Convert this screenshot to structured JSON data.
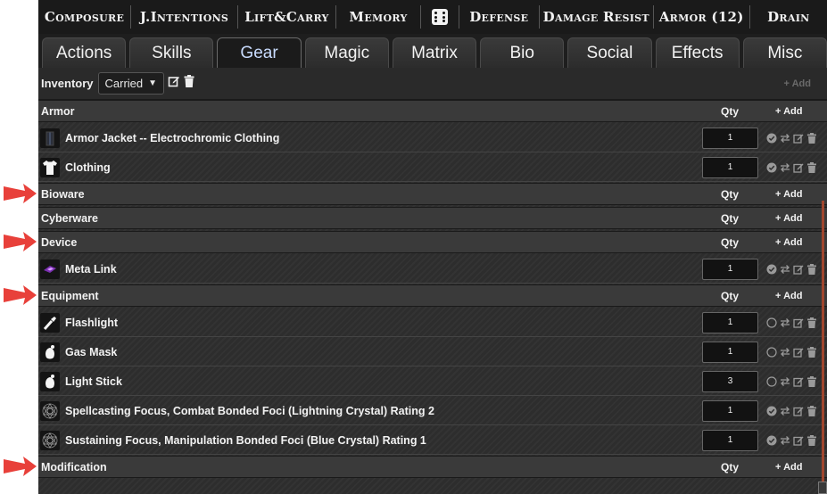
{
  "stats": [
    {
      "label": "Composure",
      "width": 104
    },
    {
      "label": "J.Intentions",
      "width": 120
    },
    {
      "label": "Lift&Carry",
      "width": 110
    },
    {
      "label": "Memory",
      "width": 95
    },
    {
      "label": "",
      "width": 42,
      "dice": true
    },
    {
      "label": "Defense",
      "width": 90
    },
    {
      "label": "Damage Resist",
      "width": 128
    },
    {
      "label": "Armor (12)",
      "width": 108
    },
    {
      "label": "Drain",
      "width": 87
    }
  ],
  "tabs": [
    "Actions",
    "Skills",
    "Gear",
    "Magic",
    "Matrix",
    "Bio",
    "Social",
    "Effects",
    "Misc"
  ],
  "active_tab": "Gear",
  "inventory": {
    "label": "Inventory",
    "selected": "Carried",
    "add_label": "+ Add"
  },
  "qty_header": "Qty",
  "add_label": "Add",
  "sections": [
    {
      "title": "Armor",
      "items": [
        {
          "name": "Armor Jacket -- Electrochromic Clothing",
          "qty": "1",
          "icon": "jacket-icon",
          "equipped": true
        },
        {
          "name": "Clothing",
          "qty": "1",
          "icon": "shirt-icon",
          "equipped": true
        }
      ]
    },
    {
      "title": "Bioware",
      "items": []
    },
    {
      "title": "Cyberware",
      "items": []
    },
    {
      "title": "Device",
      "items": [
        {
          "name": "Meta Link",
          "qty": "1",
          "icon": "commlink-icon",
          "equipped": true
        }
      ]
    },
    {
      "title": "Equipment",
      "items": [
        {
          "name": "Flashlight",
          "qty": "1",
          "icon": "flashlight-icon",
          "equipped": false
        },
        {
          "name": "Gas Mask",
          "qty": "1",
          "icon": "gas-mask-icon",
          "equipped": false
        },
        {
          "name": "Light Stick",
          "qty": "3",
          "icon": "light-stick-icon",
          "equipped": false
        },
        {
          "name": "Spellcasting Focus, Combat Bonded Foci (Lightning Crystal) Rating 2",
          "qty": "1",
          "icon": "focus-crystal-icon",
          "equipped": true
        },
        {
          "name": "Sustaining Focus, Manipulation Bonded Foci (Blue Crystal) Rating 1",
          "qty": "1",
          "icon": "focus-crystal-icon",
          "equipped": true
        }
      ]
    },
    {
      "title": "Modification",
      "items": []
    }
  ],
  "colors": {
    "arrow": "#e8403a",
    "active_tab_text": "#c9dcff",
    "sheet_bg": "#2e2e2e"
  }
}
